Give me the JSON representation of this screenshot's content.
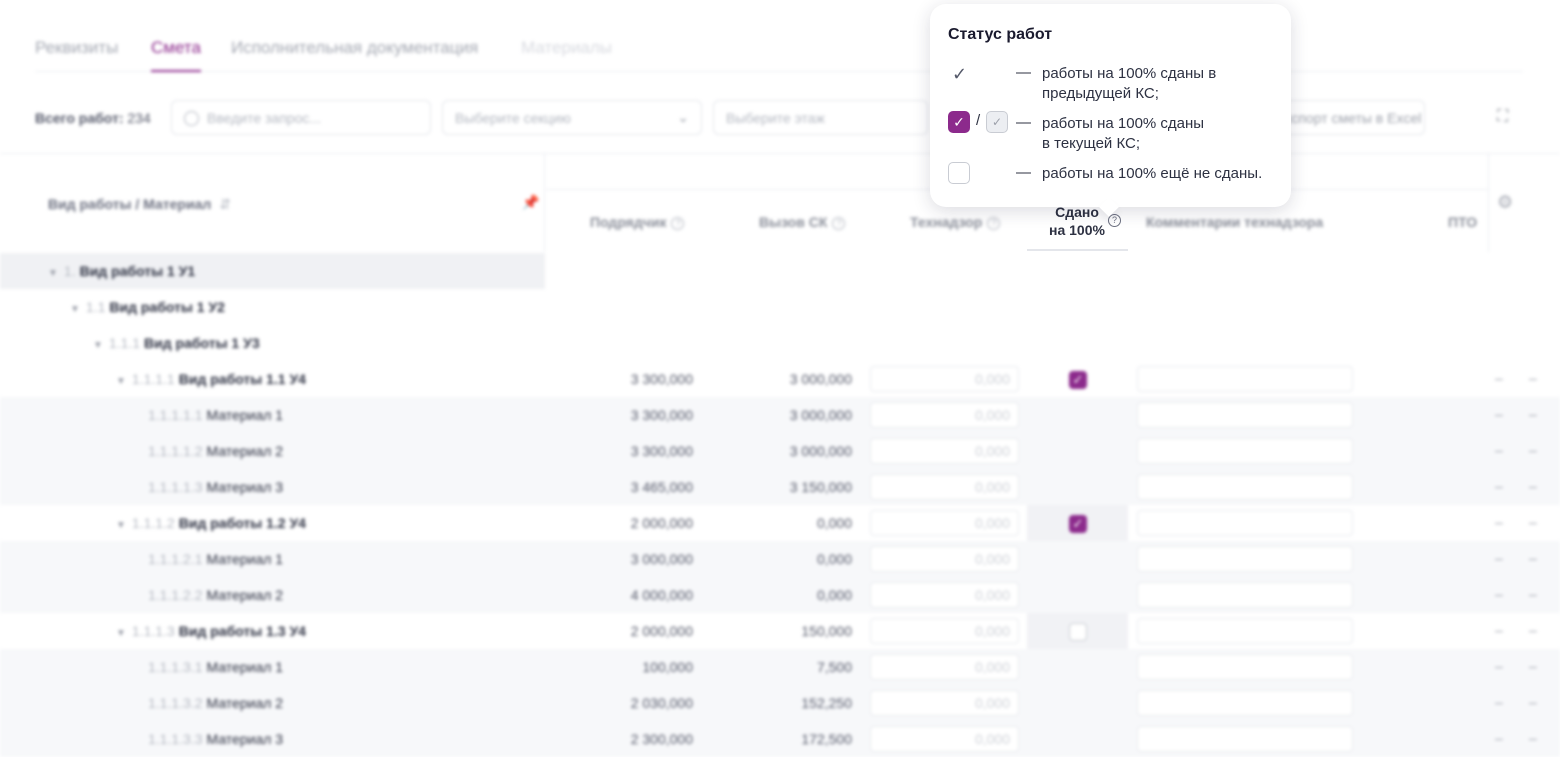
{
  "tabs": [
    {
      "label": "Реквизиты"
    },
    {
      "label": "Смета"
    },
    {
      "label": "Исполнительная документация"
    },
    {
      "label": "Материалы"
    }
  ],
  "toolbar": {
    "total_label": "Всего работ:",
    "total_value": "234",
    "search_placeholder": "Введите запрос...",
    "section_placeholder": "Выберите секцию",
    "floor_placeholder": "Выберите этаж",
    "excel_label": "Экспорт сметы в Excel"
  },
  "columns": {
    "work": "Вид работы / Материал",
    "contractor": "Подрядчик",
    "sk_call": "Вызов СК",
    "supervision": "Технадзор",
    "done_line1": "Сдано",
    "done_line2": "на 100%",
    "comments": "Комментарии технадзора",
    "pto": "ПТО"
  },
  "rows": [
    {
      "num": "1.",
      "name": "Вид работы 1 У1"
    },
    {
      "num": "1.1",
      "name": "Вид работы 1 У2"
    },
    {
      "num": "1.1.1",
      "name": "Вид работы 1 У3"
    },
    {
      "num": "1.1.1.1",
      "name": "Вид работы 1.1 У4",
      "contractor": "3 300,000",
      "sk": "3 000,000",
      "tech": "0,000",
      "dash": "–"
    },
    {
      "num": "1.1.1.1.1",
      "name": "Материал 1",
      "contractor": "3 300,000",
      "sk": "3 000,000",
      "tech": "0,000",
      "dash": "–"
    },
    {
      "num": "1.1.1.1.2",
      "name": "Материал 2",
      "contractor": "3 300,000",
      "sk": "3 000,000",
      "tech": "0,000",
      "dash": "–"
    },
    {
      "num": "1.1.1.1.3",
      "name": "Материал 3",
      "contractor": "3 465,000",
      "sk": "3 150,000",
      "tech": "0,000",
      "dash": "–"
    },
    {
      "num": "1.1.1.2",
      "name": "Вид работы 1.2 У4",
      "contractor": "2 000,000",
      "sk": "0,000",
      "tech": "0,000",
      "dash": "–"
    },
    {
      "num": "1.1.1.2.1",
      "name": "Материал 1",
      "contractor": "3 000,000",
      "sk": "0,000",
      "tech": "0,000",
      "dash": "–"
    },
    {
      "num": "1.1.1.2.2",
      "name": "Материал 2",
      "contractor": "4 000,000",
      "sk": "0,000",
      "tech": "0,000",
      "dash": "–"
    },
    {
      "num": "1.1.1.3",
      "name": "Вид работы 1.3 У4",
      "contractor": "2 000,000",
      "sk": "150,000",
      "tech": "0,000",
      "dash": "–"
    },
    {
      "num": "1.1.1.3.1",
      "name": "Материал 1",
      "contractor": "100,000",
      "sk": "7,500",
      "tech": "0,000",
      "dash": "–"
    },
    {
      "num": "1.1.1.3.2",
      "name": "Материал 2",
      "contractor": "2 030,000",
      "sk": "152,250",
      "tech": "0,000",
      "dash": "–"
    },
    {
      "num": "1.1.1.3.3",
      "name": "Материал 3",
      "contractor": "2 300,000",
      "sk": "172,500",
      "tech": "0,000",
      "dash": "–"
    }
  ],
  "popover": {
    "title": "Статус работ",
    "dash": "—",
    "slash": "/",
    "item1_line1": "работы на 100% сданы в",
    "item1_line2": "предыдущей КС;",
    "item2_line1": "работы на 100% сданы",
    "item2_line2": "в текущей КС;",
    "item3": "работы на 100% ещё не сданы."
  },
  "colors": {
    "accent": "#8c2a8c"
  },
  "icons": [
    "search-icon",
    "chevron-down-icon",
    "fullscreen-icon",
    "sort-icon",
    "pin-icon",
    "help-icon",
    "gear-icon",
    "check-icon"
  ]
}
